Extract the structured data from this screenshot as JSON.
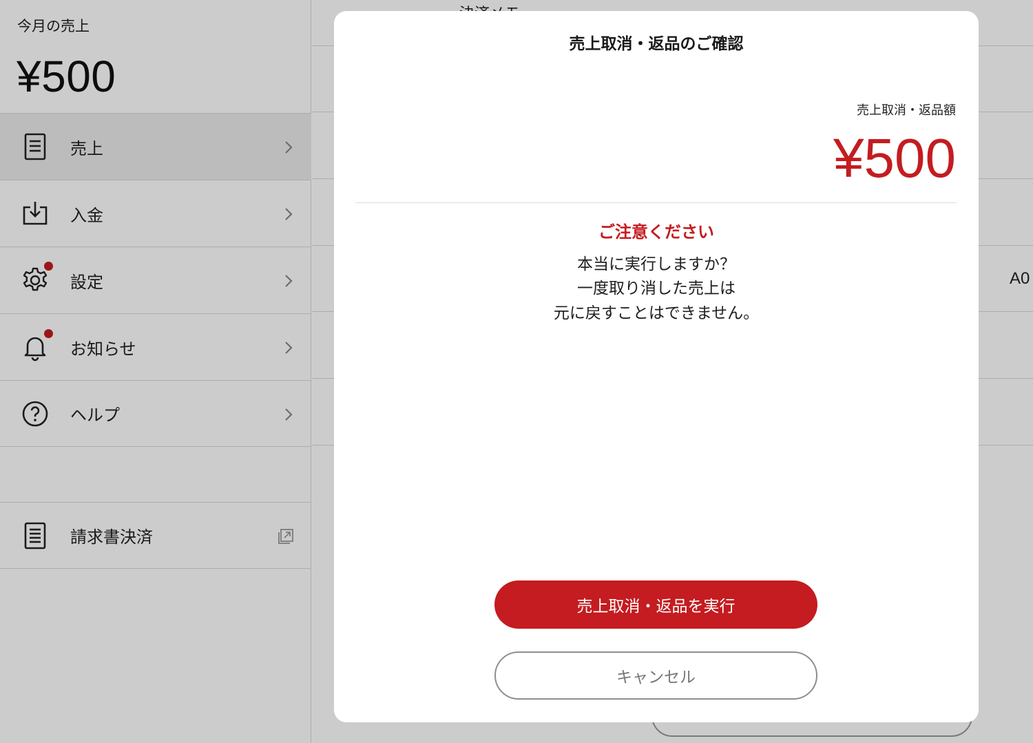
{
  "sidebar": {
    "sales_label": "今月の売上",
    "sales_amount": "¥500",
    "items": [
      {
        "label": "売上",
        "icon": "document-icon"
      },
      {
        "label": "入金",
        "icon": "download-tray-icon"
      },
      {
        "label": "設定",
        "icon": "gear-icon",
        "badge": true
      },
      {
        "label": "お知らせ",
        "icon": "bell-icon",
        "badge": true
      },
      {
        "label": "ヘルプ",
        "icon": "question-circle-icon"
      }
    ],
    "external_item": {
      "label": "請求書決済",
      "icon": "document-icon"
    }
  },
  "content": {
    "memo_label": "決済メモ",
    "code_text": "A0"
  },
  "modal": {
    "title": "売上取消・返品のご確認",
    "amount_caption": "売上取消・返品額",
    "amount_value": "¥500",
    "warning_title": "ご注意ください",
    "warning_lines": [
      "本当に実行しますか？",
      "一度取り消した売上は",
      "元に戻すことはできません。"
    ],
    "execute_label": "売上取消・返品を実行",
    "cancel_label": "キャンセル"
  },
  "colors": {
    "accent": "#c41c20",
    "overlay": "rgba(0,0,0,0.2)"
  }
}
